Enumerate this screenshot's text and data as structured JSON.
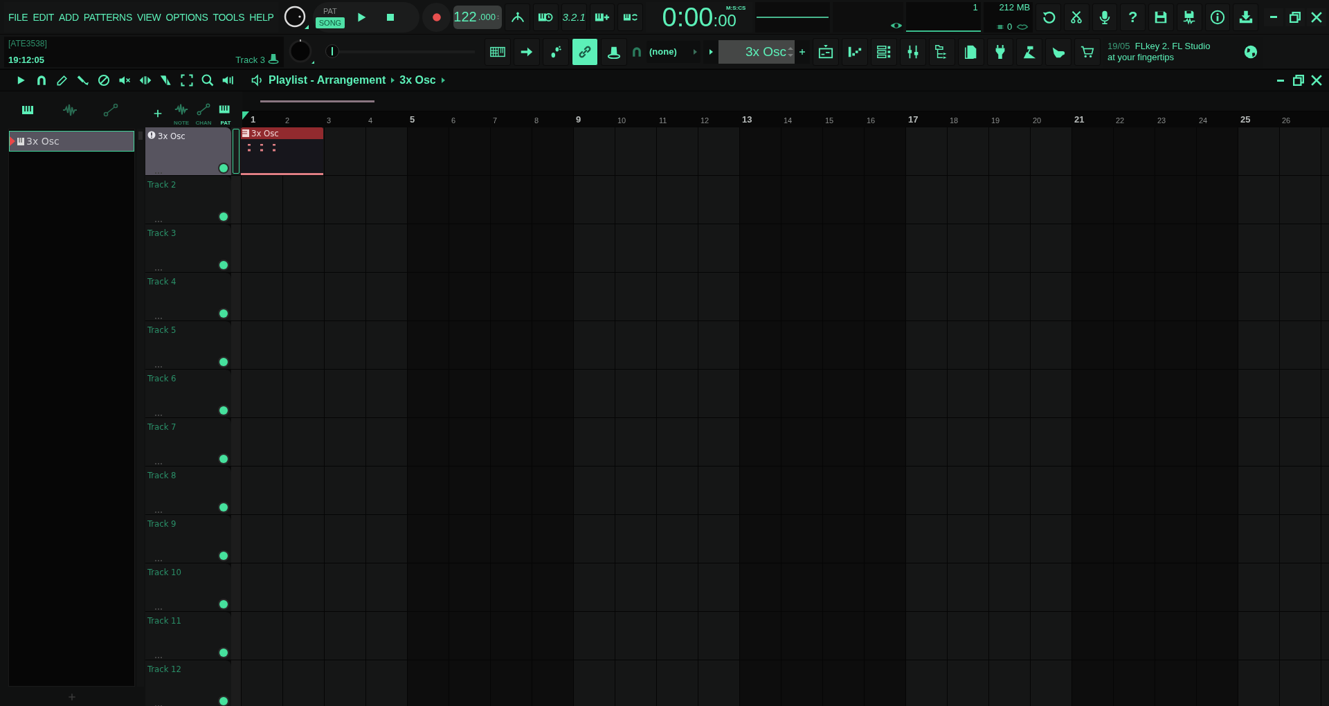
{
  "menu": [
    "FILE",
    "EDIT",
    "ADD",
    "PATTERNS",
    "VIEW",
    "OPTIONS",
    "TOOLS",
    "HELP"
  ],
  "transport": {
    "modes": [
      {
        "label": "PAT",
        "selected": false
      },
      {
        "label": "SONG",
        "selected": true
      }
    ],
    "tempo": "122",
    "tempo_decimals": ".000"
  },
  "countdown_button": "3.2.1",
  "hint_panel": {
    "hint": "[ATE3538]",
    "time": "19:12:05",
    "target": "Track 3"
  },
  "master_slider": {
    "level": 0
  },
  "time_display": {
    "main": "0:00",
    "centiseconds": ":00",
    "format": "M:S:CS"
  },
  "cpu_meter": {
    "value": "1"
  },
  "memory": {
    "value": "212 MB",
    "polyphony": "0"
  },
  "help_button": "?",
  "link_button": {
    "on": true
  },
  "snap": {
    "value": "(none)"
  },
  "pattern_selector": {
    "value": "3x Osc"
  },
  "news": {
    "date": "19/05",
    "text": "FLkey 2. FL Studio at your fingertips"
  },
  "playlist": {
    "title": "Playlist - Arrangement",
    "pattern": "3x Osc",
    "picker_tabs": [
      {
        "label": "NOTE",
        "selected": false
      },
      {
        "label": "CHAN",
        "selected": false
      },
      {
        "label": "PAT",
        "selected": true
      }
    ],
    "picker_items": [
      {
        "name": "3x Osc",
        "selected": true
      }
    ],
    "ruler": [
      "1",
      "2",
      "3",
      "4",
      "5",
      "6",
      "7",
      "8",
      "9",
      "10",
      "11",
      "12",
      "13",
      "14",
      "15",
      "16",
      "17",
      "18",
      "19",
      "20",
      "21",
      "22",
      "23",
      "24",
      "25",
      "26"
    ],
    "tracks": [
      {
        "name": "3x Osc",
        "selected": true,
        "info_icon": true,
        "enabled": true,
        "clips": [
          {
            "name": "3x Osc"
          }
        ]
      },
      {
        "name": "Track 2",
        "selected": false,
        "info_icon": false,
        "enabled": true
      },
      {
        "name": "Track 3",
        "selected": false,
        "info_icon": false,
        "enabled": true
      },
      {
        "name": "Track 4",
        "selected": false,
        "info_icon": false,
        "enabled": true
      },
      {
        "name": "Track 5",
        "selected": false,
        "info_icon": false,
        "enabled": true
      },
      {
        "name": "Track 6",
        "selected": false,
        "info_icon": false,
        "enabled": true
      },
      {
        "name": "Track 7",
        "selected": false,
        "info_icon": false,
        "enabled": true
      },
      {
        "name": "Track 8",
        "selected": false,
        "info_icon": false,
        "enabled": true
      },
      {
        "name": "Track 9",
        "selected": false,
        "info_icon": false,
        "enabled": true
      },
      {
        "name": "Track 10",
        "selected": false,
        "info_icon": false,
        "enabled": true
      },
      {
        "name": "Track 11",
        "selected": false,
        "info_icon": false,
        "enabled": true
      },
      {
        "name": "Track 12",
        "selected": false,
        "info_icon": false,
        "enabled": true
      }
    ]
  }
}
